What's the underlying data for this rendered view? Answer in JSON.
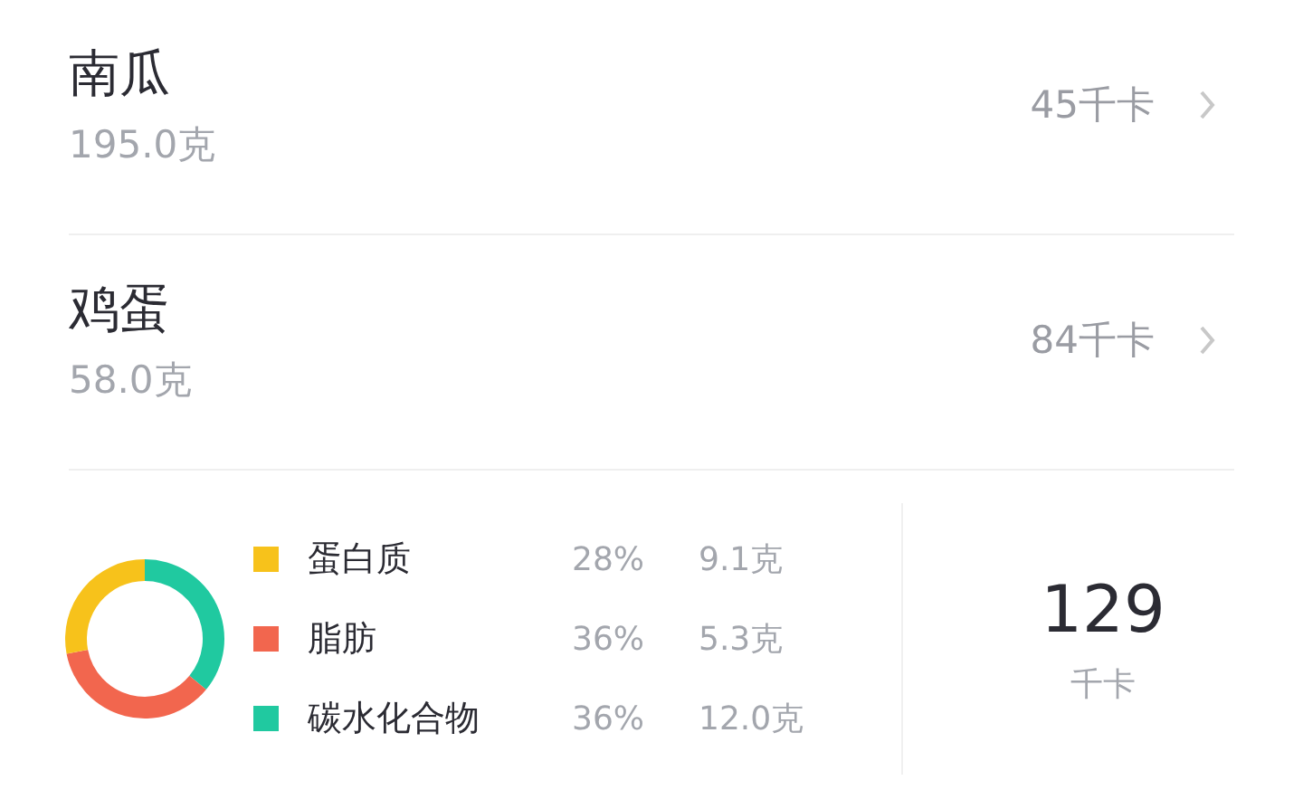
{
  "foods": [
    {
      "name": "南瓜",
      "weight": "195.0克",
      "calories": "45千卡"
    },
    {
      "name": "鸡蛋",
      "weight": "58.0克",
      "calories": "84千卡"
    }
  ],
  "summary": {
    "nutrients": [
      {
        "name": "蛋白质",
        "percent": "28%",
        "amount": "9.1克",
        "color": "#f7c21b"
      },
      {
        "name": "脂肪",
        "percent": "36%",
        "amount": "5.3克",
        "color": "#f2664e"
      },
      {
        "name": "碳水化合物",
        "percent": "36%",
        "amount": "12.0克",
        "color": "#20c9a0"
      }
    ],
    "total": "129",
    "total_unit": "千卡"
  }
}
